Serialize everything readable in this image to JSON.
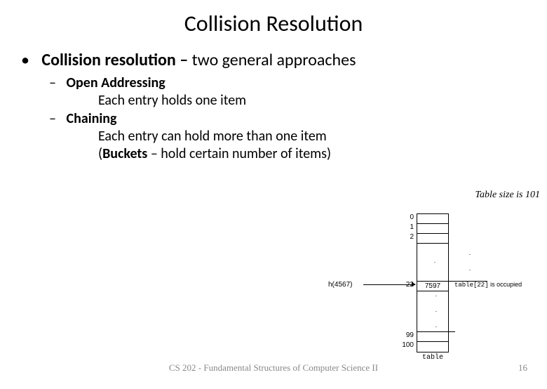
{
  "title": "Collision Resolution",
  "bullet1": {
    "bold": "Collision resolution – ",
    "rest": "two general approaches"
  },
  "sub1": {
    "label": "Open Addressing",
    "detail": "Each entry holds one item"
  },
  "sub2": {
    "label": "Chaining",
    "detail1": "Each entry can hold more than one item",
    "detail2a": "(",
    "detail2b": "Buckets",
    "detail2c": " – hold certain number of items)"
  },
  "note": "Table size is 101",
  "diagram": {
    "idx0": "0",
    "idx1": "1",
    "idx2": "2",
    "idx22": "22",
    "idx99": "99",
    "idx100": "100",
    "val22": "7597",
    "hfn": "h(4567)",
    "occupied_a": "table[22]",
    "occupied_b": " is occupied",
    "table_label": "table",
    "dots": "·  ·  ·"
  },
  "footer": {
    "center": "CS 202 - Fundamental Structures of Computer Science II",
    "page": "16"
  }
}
